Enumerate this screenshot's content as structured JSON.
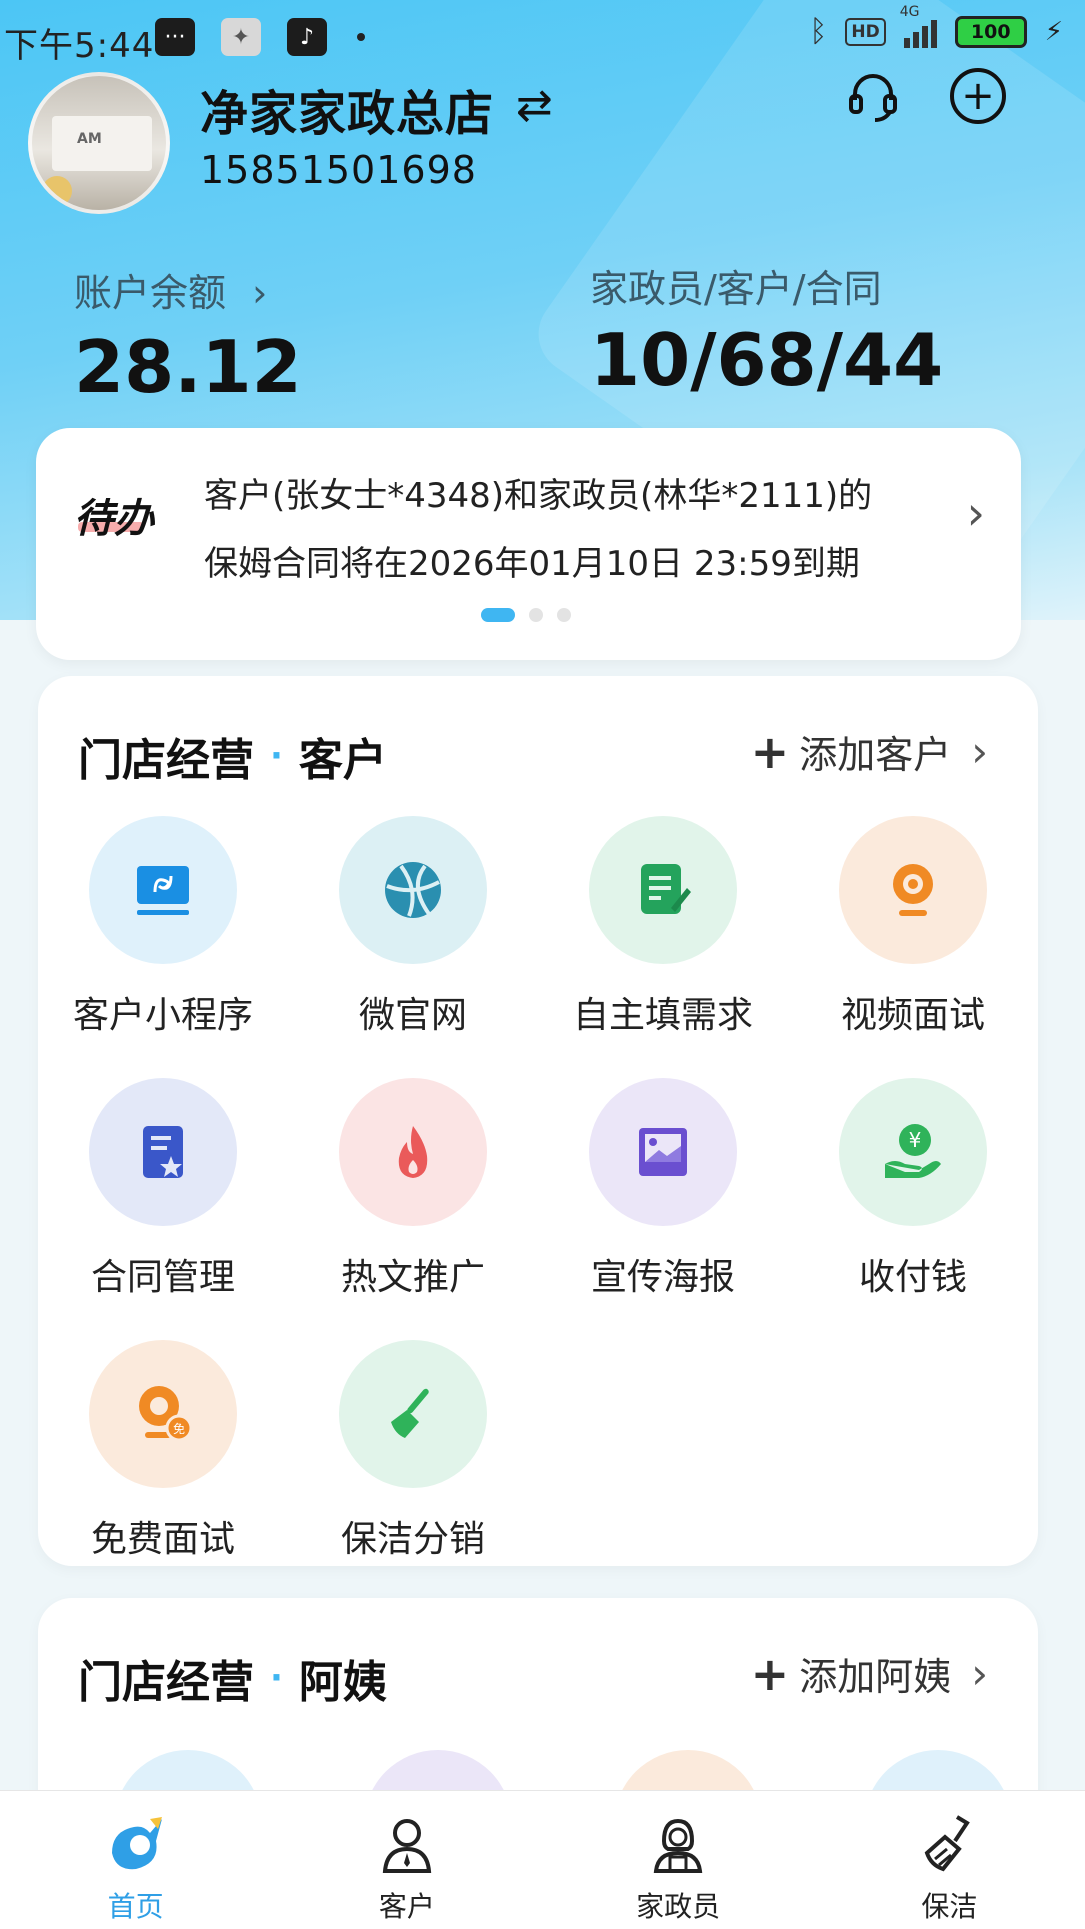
{
  "status_bar": {
    "time": "下午5:44",
    "hd": "HD",
    "network": "4G",
    "battery": "100"
  },
  "store": {
    "name": "净家家政总店",
    "phone": "15851501698",
    "avatar_logo": "AM"
  },
  "stats": {
    "balance_label": "账户余额",
    "balance_value": "28.12",
    "counts_label": "家政员/客户/合同",
    "counts_value": "10/68/44"
  },
  "todo": {
    "badge": "待办",
    "line1": "客户(张女士*4348)和家政员(林华*2111)的",
    "line2": "保姆合同将在2026年01月10日 23:59到期"
  },
  "section_customers": {
    "title_main": "门店经营",
    "title_sep": "·",
    "title_sub": "客户",
    "action_plus": "+",
    "action_label": "添加客户",
    "items": [
      {
        "label": "客户小程序",
        "icon": "mini-program-icon",
        "color": "#1a8fe3"
      },
      {
        "label": "微官网",
        "icon": "globe-icon",
        "color": "#2a9bb8"
      },
      {
        "label": "自主填需求",
        "icon": "edit-form-icon",
        "color": "#24a35c"
      },
      {
        "label": "视频面试",
        "icon": "webcam-icon",
        "color": "#f08a24"
      },
      {
        "label": "合同管理",
        "icon": "contract-icon",
        "color": "#3a57c9"
      },
      {
        "label": "热文推广",
        "icon": "fire-icon",
        "color": "#ea5a5a"
      },
      {
        "label": "宣传海报",
        "icon": "poster-icon",
        "color": "#6a4fd0"
      },
      {
        "label": "收付钱",
        "icon": "payment-icon",
        "color": "#2fb35a"
      },
      {
        "label": "免费面试",
        "icon": "free-interview-icon",
        "color": "#f08a24"
      },
      {
        "label": "保洁分销",
        "icon": "broom-icon",
        "color": "#2fb35a"
      }
    ]
  },
  "section_aunties": {
    "title_main": "门店经营",
    "title_sep": "·",
    "title_sub": "阿姨",
    "action_plus": "+",
    "action_label": "添加阿姨"
  },
  "bottom_nav": [
    {
      "label": "首页",
      "icon": "home-logo-icon",
      "active": true
    },
    {
      "label": "客户",
      "icon": "person-icon",
      "active": false
    },
    {
      "label": "家政员",
      "icon": "housekeeper-icon",
      "active": false
    },
    {
      "label": "保洁",
      "icon": "broom-icon",
      "active": false
    }
  ],
  "colors": {
    "accent": "#3fb6f2",
    "header_gradient_top": "#4cc6f5",
    "active_nav": "#2f9fe6"
  }
}
